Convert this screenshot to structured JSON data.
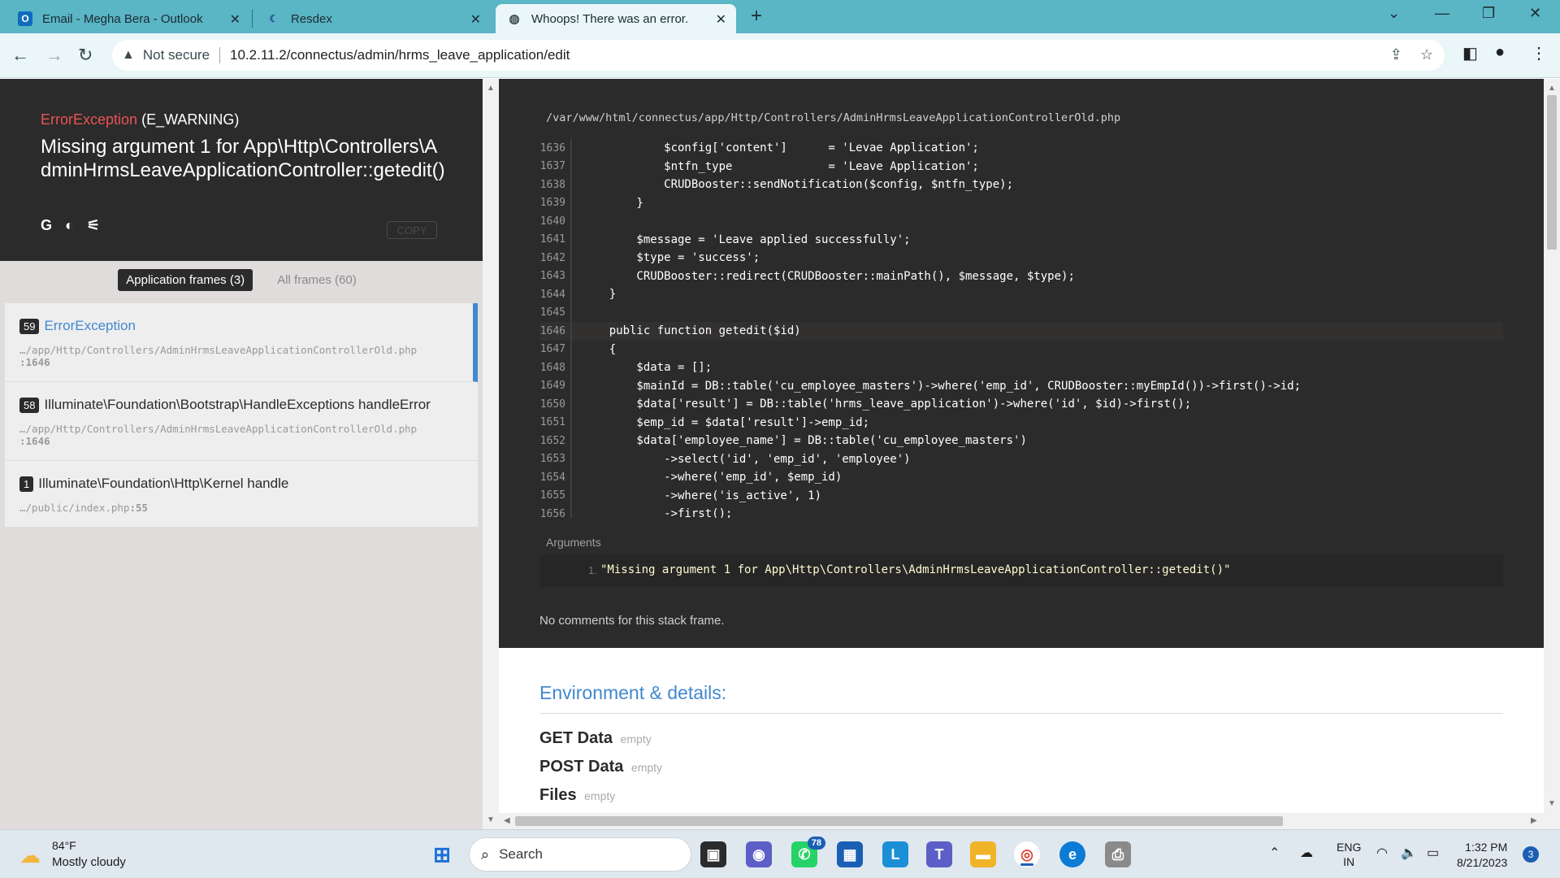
{
  "browser": {
    "tabs": [
      {
        "title": "Email - Megha Bera - Outlook",
        "icon": "outlook-icon"
      },
      {
        "title": "Resdex",
        "icon": "resdex-icon"
      },
      {
        "title": "Whoops! There was an error.",
        "icon": "globe-icon"
      }
    ],
    "security_label": "Not secure",
    "url": "10.2.11.2/connectus/admin/hrms_leave_application/edit"
  },
  "error": {
    "exception_class": "ErrorException",
    "exception_code": "(E_WARNING)",
    "message": "Missing argument 1 for App\\Http\\Controllers\\AdminHrmsLeaveApplicationController::getedit()",
    "copy_label": "COPY"
  },
  "frames_tabs": {
    "application": "Application frames (3)",
    "all": "All frames (60)"
  },
  "frames": [
    {
      "index": "59",
      "class": "ErrorException",
      "file": "…/app/Http/Controllers/AdminHrmsLeaveApplicationControllerOld.php",
      "line": ":1646"
    },
    {
      "index": "58",
      "class": "Illuminate\\Foundation\\Bootstrap\\HandleExceptions handleError",
      "file": "…/app/Http/Controllers/AdminHrmsLeaveApplicationControllerOld.php",
      "line": ":1646"
    },
    {
      "index": "1",
      "class": "Illuminate\\Foundation\\Http\\Kernel handle",
      "file": "…/public/index.php",
      "line": ":55"
    }
  ],
  "code_view": {
    "file_path": "/var/www/html/connectus/app/Http/Controllers/AdminHrmsLeaveApplicationControllerOld.php",
    "highlight_line": "1646",
    "lines": [
      {
        "n": "1636",
        "code": "            $config['content']      = 'Levae Application';"
      },
      {
        "n": "1637",
        "code": "            $ntfn_type              = 'Leave Application';"
      },
      {
        "n": "1638",
        "code": "            CRUDBooster::sendNotification($config, $ntfn_type);"
      },
      {
        "n": "1639",
        "code": "        }"
      },
      {
        "n": "1640",
        "code": ""
      },
      {
        "n": "1641",
        "code": "        $message = 'Leave applied successfully';"
      },
      {
        "n": "1642",
        "code": "        $type = 'success';"
      },
      {
        "n": "1643",
        "code": "        CRUDBooster::redirect(CRUDBooster::mainPath(), $message, $type);"
      },
      {
        "n": "1644",
        "code": "    }"
      },
      {
        "n": "1645",
        "code": ""
      },
      {
        "n": "1646",
        "code": "    public function getedit($id)"
      },
      {
        "n": "1647",
        "code": "    {"
      },
      {
        "n": "1648",
        "code": "        $data = [];"
      },
      {
        "n": "1649",
        "code": "        $mainId = DB::table('cu_employee_masters')->where('emp_id', CRUDBooster::myEmpId())->first()->id;"
      },
      {
        "n": "1650",
        "code": "        $data['result'] = DB::table('hrms_leave_application')->where('id', $id)->first();"
      },
      {
        "n": "1651",
        "code": "        $emp_id = $data['result']->emp_id;"
      },
      {
        "n": "1652",
        "code": "        $data['employee_name'] = DB::table('cu_employee_masters')"
      },
      {
        "n": "1653",
        "code": "            ->select('id', 'emp_id', 'employee')"
      },
      {
        "n": "1654",
        "code": "            ->where('emp_id', $emp_id)"
      },
      {
        "n": "1655",
        "code": "            ->where('is_active', 1)"
      },
      {
        "n": "1656",
        "code": "            ->first();"
      }
    ],
    "arguments_label": "Arguments",
    "argument_index": "1.",
    "argument_value": "\"Missing argument 1 for App\\Http\\Controllers\\AdminHrmsLeaveApplicationController::getedit()\"",
    "no_comments": "No comments for this stack frame."
  },
  "environment": {
    "title": "Environment & details:",
    "rows": [
      {
        "label": "GET Data",
        "value": "empty"
      },
      {
        "label": "POST Data",
        "value": "empty"
      },
      {
        "label": "Files",
        "value": "empty"
      }
    ]
  },
  "taskbar": {
    "weather_temp": "84°F",
    "weather_desc": "Mostly cloudy",
    "search_label": "Search",
    "whatsapp_badge": "78",
    "lang_top": "ENG",
    "lang_bottom": "IN",
    "time": "1:32 PM",
    "date": "8/21/2023",
    "notifications": "3"
  },
  "colors": {
    "tab_bar": "#5ab5c5",
    "error_header": "#2b2b2b",
    "exception_red": "#e95353",
    "link_blue": "#4288ce"
  }
}
